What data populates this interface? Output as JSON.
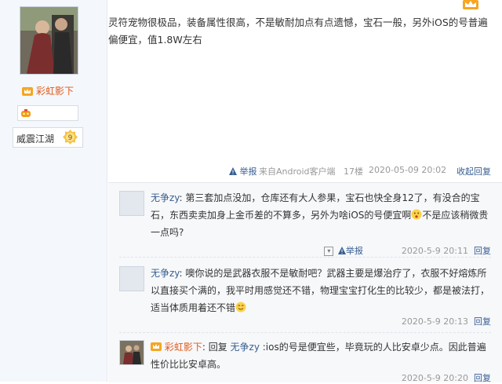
{
  "sidebar": {
    "username": "彩虹影下",
    "title_label": "威震江湖",
    "level": "9"
  },
  "post": {
    "text": "灵符宠物很极品，装备属性很高，不是敏耐加点有点遗憾，宝石一般，另外iOS的号普遍偏便宜，值1.8W左右",
    "report": "举报",
    "source": "来自Android客户端",
    "floor": "17楼",
    "date": "2020-05-09 20:02",
    "collapse": "收起回复"
  },
  "replies": [
    {
      "name": "无争zy",
      "text_before_emoji": ": 第三套加点没加，仓库还有大人参果，宝石也快全身12了，有没合的宝石，东西卖卖加身上金币差的不算多，另外为啥iOS的号便宜啊",
      "text_after_emoji": "不是应该稍微贵一点吗?",
      "report": "举报",
      "date": "2020-5-9 20:11",
      "reply_label": "回复"
    },
    {
      "name": "无争zy",
      "text_before_emoji": ": 噢你说的是武器衣服不是敏耐吧？武器主要是爆治疗了，衣服不好熔炼所以直接买个满的，我平时用感觉还不错，物理宝宝打化生的比较少，都是被法打，适当体质用着还不错",
      "text_after_emoji": "",
      "date": "2020-5-9 20:13",
      "reply_label": "回复"
    },
    {
      "name": "彩虹影下",
      "reply_prefix": ": 回复",
      "reply_target": "无争zy",
      "text": " :ios的号是便宜些，毕竟玩的人比安卓少点。因此普遍性价比比安卓高。",
      "date": "2020-5-9 20:20",
      "reply_label": "回复"
    }
  ],
  "colors": {
    "link": "#375e92",
    "username": "#e15a1b",
    "meta": "#999999",
    "panel_bg": "#f7f8fa"
  }
}
